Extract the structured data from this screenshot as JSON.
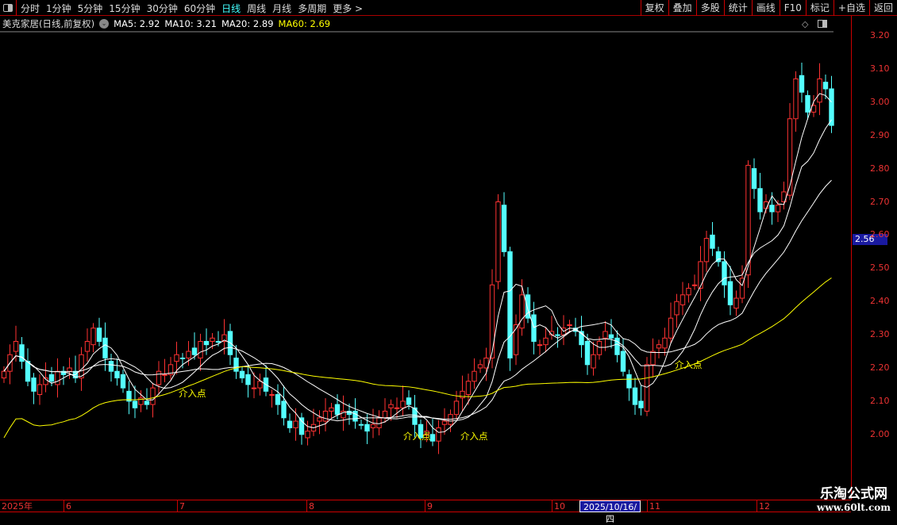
{
  "toolbar": {
    "periods": [
      "分时",
      "1分钟",
      "5分钟",
      "15分钟",
      "30分钟",
      "60分钟",
      "日线",
      "周线",
      "月线",
      "多周期",
      "更多 >"
    ],
    "active": "日线",
    "right_buttons": [
      "复权",
      "叠加",
      "多股",
      "统计",
      "画线",
      "F10",
      "标记",
      "+自选",
      "返回"
    ]
  },
  "legend": {
    "title": "美克家居(日线,前复权)",
    "ma5": "MA5: 2.92",
    "ma10": "MA10: 3.21",
    "ma20": "MA20: 2.89",
    "ma60": "MA60: 2.69"
  },
  "colors": {
    "up": "#ff3232",
    "down": "#54ffff",
    "ma5": "#ffffff",
    "ma10": "#ffffff",
    "ma20": "#ffffff",
    "ma60": "#ffff00",
    "axis": "#cc0000"
  },
  "price_label": "2.56",
  "annotations": [
    "介入点",
    "介入点",
    "介入点",
    "介入点"
  ],
  "x_axis": {
    "labels": [
      "2025年",
      "6",
      "7",
      "8",
      "9",
      "10",
      "11",
      "12"
    ],
    "highlight": "2025/10/16/四"
  },
  "watermark": {
    "name": "乐淘公式网",
    "url": "www.60lt.com"
  },
  "chart_data": {
    "type": "candlestick",
    "y_ticks": [
      "3.20",
      "3.10",
      "3.00",
      "2.90",
      "2.80",
      "2.70",
      "2.60",
      "2.50",
      "2.40",
      "2.30",
      "2.20",
      "2.10",
      "2.00"
    ],
    "ylim": [
      1.9,
      3.24
    ],
    "closes": [
      2.19,
      2.24,
      2.28,
      2.22,
      2.16,
      2.13,
      2.15,
      2.17,
      2.16,
      2.19,
      2.18,
      2.2,
      2.17,
      2.24,
      2.28,
      2.32,
      2.28,
      2.23,
      2.19,
      2.17,
      2.14,
      2.1,
      2.08,
      2.11,
      2.09,
      2.14,
      2.19,
      2.18,
      2.21,
      2.24,
      2.23,
      2.25,
      2.24,
      2.28,
      2.27,
      2.29,
      2.28,
      2.3,
      2.24,
      2.19,
      2.17,
      2.15,
      2.14,
      2.16,
      2.13,
      2.12,
      2.09,
      2.05,
      2.02,
      2.04,
      2.0,
      2.01,
      2.03,
      2.05,
      2.07,
      2.08,
      2.06,
      2.07,
      2.06,
      2.04,
      2.03,
      2.01,
      2.03,
      2.05,
      2.07,
      2.09,
      2.08,
      2.1,
      2.09,
      2.03,
      1.99,
      2.01,
      1.98,
      2.02,
      2.04,
      2.06,
      2.1,
      2.13,
      2.16,
      2.19,
      2.21,
      2.23,
      2.45,
      2.7,
      2.55,
      2.23,
      2.33,
      2.42,
      2.35,
      2.28,
      2.27,
      2.29,
      2.31,
      2.3,
      2.32,
      2.33,
      2.31,
      2.27,
      2.21,
      2.24,
      2.28,
      2.31,
      2.29,
      2.24,
      2.19,
      2.14,
      2.09,
      2.08,
      2.21,
      2.25,
      2.27,
      2.29,
      2.35,
      2.4,
      2.42,
      2.44,
      2.45,
      2.52,
      2.59,
      2.56,
      2.52,
      2.45,
      2.39,
      2.41,
      2.47,
      2.81,
      2.74,
      2.67,
      2.7,
      2.67,
      2.69,
      2.73,
      2.95,
      3.07,
      3.03,
      2.97,
      2.99,
      3.07,
      3.04,
      2.93
    ]
  }
}
